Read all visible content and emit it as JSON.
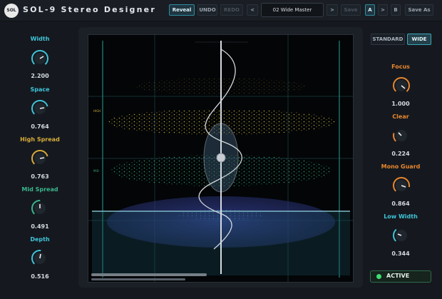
{
  "app": {
    "logo": "SOL",
    "title": "SOL-9 Stereo Designer"
  },
  "toolbar": {
    "reveal": "Reveal",
    "undo": "UNDO",
    "redo": "REDO",
    "prev": "<",
    "next": ">",
    "preset": "02 Wide Master",
    "save": "Save",
    "a": "A",
    "ab_arrow": ">",
    "b": "B",
    "save_as": "Save As"
  },
  "left_knobs": [
    {
      "label": "Width",
      "value": "2.200",
      "color": "#3fc4d8"
    },
    {
      "label": "Space",
      "value": "0.764",
      "color": "#3fc4d8"
    },
    {
      "label": "High Spread",
      "value": "0.763",
      "color": "#d9ab3a"
    },
    {
      "label": "Mid Spread",
      "value": "0.491",
      "color": "#3ab58c"
    },
    {
      "label": "Depth",
      "value": "0.516",
      "color": "#3fc4d8"
    }
  ],
  "right_knobs": [
    {
      "label": "Focus",
      "value": "1.000",
      "color": "#e8862f"
    },
    {
      "label": "Clear",
      "value": "0.224",
      "color": "#e8862f"
    },
    {
      "label": "Mono Guard",
      "value": "0.864",
      "color": "#e8862f"
    },
    {
      "label": "Low Width",
      "value": "0.344",
      "color": "#3fc4d8"
    }
  ],
  "modes": {
    "standard": "STANDARD",
    "wide": "WIDE"
  },
  "scope": {
    "high_label": "HIGH",
    "mid_label": "MID"
  },
  "status": {
    "active": "ACTIVE"
  }
}
